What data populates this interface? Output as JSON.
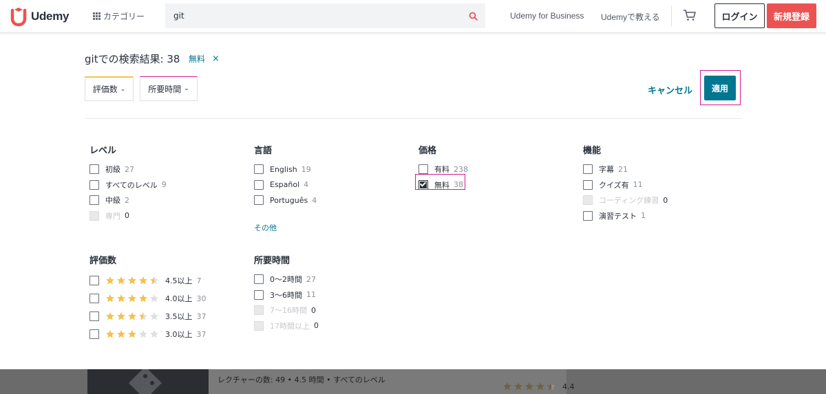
{
  "header": {
    "logo_text": "Udemy",
    "categories_label": "カテゴリー",
    "search_value": "git",
    "business_link": "Udemy for Business",
    "teach_link": "Udemyで教える",
    "login_label": "ログイン",
    "signup_label": "新規登録",
    "colors": {
      "brand_red": "#ec5252",
      "accent_teal": "#007791"
    }
  },
  "results": {
    "title": "gitでの検索結果: 38",
    "active_chip": "無料",
    "chip_remove": "×",
    "filter_rating": "評価数",
    "filter_duration": "所要時間",
    "cancel_label": "キャンセル",
    "apply_label": "適用"
  },
  "filters": {
    "level": {
      "title": "レベル",
      "options": [
        {
          "label": "初級",
          "count": "27",
          "disabled": false
        },
        {
          "label": "すべてのレベル",
          "count": "9",
          "disabled": false
        },
        {
          "label": "中級",
          "count": "2",
          "disabled": false
        },
        {
          "label": "専門",
          "count": "0",
          "disabled": true
        }
      ]
    },
    "language": {
      "title": "言語",
      "options": [
        {
          "label": "English",
          "count": "19"
        },
        {
          "label": "Español",
          "count": "4"
        },
        {
          "label": "Português",
          "count": "4"
        }
      ],
      "more": "その他"
    },
    "price": {
      "title": "価格",
      "options": [
        {
          "label": "有料",
          "count": "238",
          "checked": false
        },
        {
          "label": "無料",
          "count": "38",
          "checked": true
        }
      ]
    },
    "features": {
      "title": "機能",
      "options": [
        {
          "label": "字幕",
          "count": "21",
          "disabled": false
        },
        {
          "label": "クイズ有",
          "count": "11",
          "disabled": false
        },
        {
          "label": "コーディング練習",
          "count": "0",
          "disabled": true
        },
        {
          "label": "演習テスト",
          "count": "1",
          "disabled": false
        }
      ]
    },
    "ratings": {
      "title": "評価数",
      "options": [
        {
          "label": "4.5以上",
          "count": "7",
          "stars": 4.5
        },
        {
          "label": "4.0以上",
          "count": "30",
          "stars": 4.0
        },
        {
          "label": "3.5以上",
          "count": "37",
          "stars": 3.5
        },
        {
          "label": "3.0以上",
          "count": "37",
          "stars": 3.0
        }
      ]
    },
    "duration": {
      "title": "所要時間",
      "options": [
        {
          "label": "0〜2時間",
          "count": "27",
          "disabled": false
        },
        {
          "label": "3〜6時間",
          "count": "11",
          "disabled": false
        },
        {
          "label": "7〜16時間",
          "count": "0",
          "disabled": true
        },
        {
          "label": "17時間以上",
          "count": "0",
          "disabled": true
        }
      ]
    }
  },
  "course_peek": {
    "lectures": "レクチャーの数: 49",
    "hours": "4.5 時間",
    "level": "すべてのレベル",
    "rating": "4.4",
    "stars": 4.5
  }
}
